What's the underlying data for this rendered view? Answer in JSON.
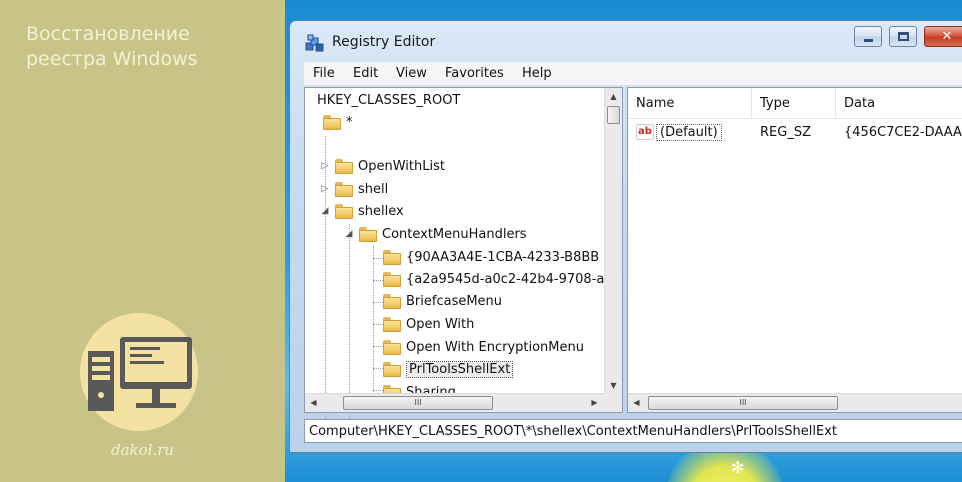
{
  "promo": {
    "title_line1": "Восстановление",
    "title_line2": "реестра Windows",
    "site": "dakol.ru"
  },
  "window": {
    "title": "Registry Editor",
    "close_glyph": "✕"
  },
  "menu": {
    "file": "File",
    "edit": "Edit",
    "view": "View",
    "favorites": "Favorites",
    "help": "Help"
  },
  "tree": {
    "root": "HKEY_CLASSES_ROOT",
    "items": [
      {
        "label": "*",
        "expander": ""
      },
      {
        "label": "OpenWithList",
        "expander": "▷"
      },
      {
        "label": "shell",
        "expander": "▷"
      },
      {
        "label": "shellex",
        "expander": "◢"
      },
      {
        "label": "ContextMenuHandlers",
        "expander": "◢"
      },
      {
        "label": "{90AA3A4E-1CBA-4233-B8BB",
        "expander": ""
      },
      {
        "label": "{a2a9545d-a0c2-42b4-9708-a",
        "expander": ""
      },
      {
        "label": "BriefcaseMenu",
        "expander": ""
      },
      {
        "label": "Open With",
        "expander": ""
      },
      {
        "label": "Open With EncryptionMenu",
        "expander": ""
      },
      {
        "label": "PrlToolsShellExt",
        "expander": ""
      },
      {
        "label": "Sharing",
        "expander": ""
      }
    ],
    "scroll_grip": "III"
  },
  "list": {
    "columns": {
      "name": "Name",
      "type": "Type",
      "data": "Data"
    },
    "rows": [
      {
        "icon": "ab",
        "name": "(Default)",
        "type": "REG_SZ",
        "data": "{456C7CE2-DAAA"
      }
    ],
    "scroll_grip": "III"
  },
  "status": {
    "path": "Computer\\HKEY_CLASSES_ROOT\\*\\shellex\\ContextMenuHandlers\\PrlToolsShellExt"
  },
  "icons": {
    "app": "registry-editor-icon",
    "folder": "folder-icon",
    "string_value": "string-value-icon",
    "illustration": "desktop-computer-icon"
  },
  "colors": {
    "panel": "#c8c487",
    "titlebar": "#c7daef",
    "close": "#c23b22",
    "accent_text": "#f3f0d6"
  }
}
